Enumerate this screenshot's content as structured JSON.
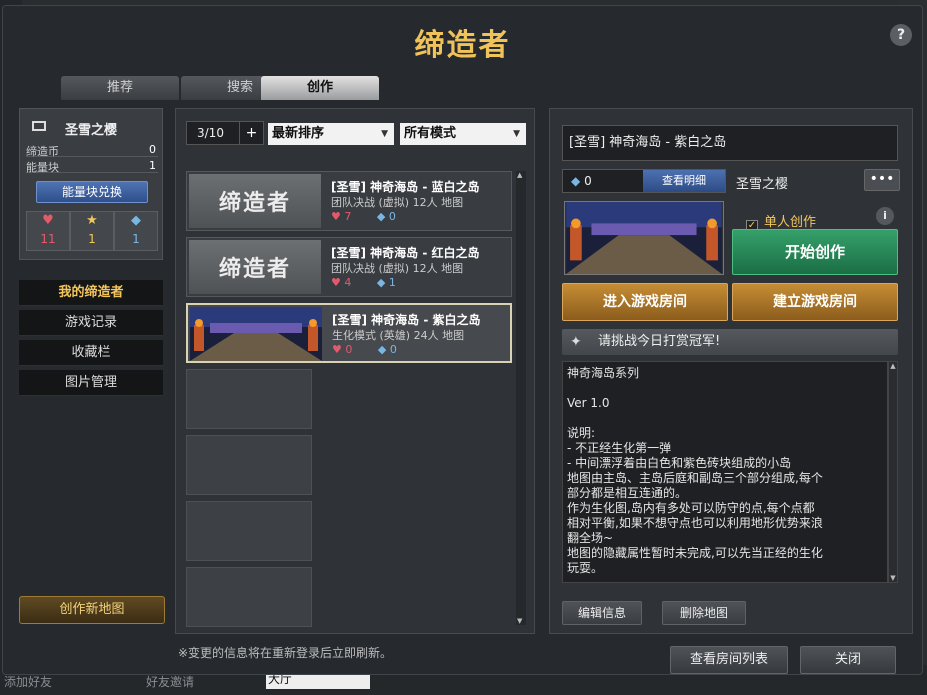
{
  "background": {
    "bottom_left_1": "添加好友",
    "bottom_left_2": "好友邀请",
    "bottom_channel": "大厅"
  },
  "dialog": {
    "title": "缔造者",
    "help": "?",
    "tabs": [
      "推荐",
      "搜索",
      "创作"
    ]
  },
  "profile": {
    "name": "圣雪之樱",
    "currency_label": "缔造币",
    "currency_value": "0",
    "energy_label": "能量块",
    "energy_value": "1",
    "exchange_button": "能量块兑换",
    "stats": [
      {
        "icon": "heart-icon",
        "glyph": "♥",
        "value": "11"
      },
      {
        "icon": "star-icon",
        "glyph": "★",
        "value": "1"
      },
      {
        "icon": "gem-icon",
        "glyph": "◆",
        "value": "1"
      }
    ]
  },
  "menu": [
    "我的缔造者",
    "游戏记录",
    "收藏栏",
    "图片管理"
  ],
  "create_new_map": "创作新地图",
  "list": {
    "page": "3/10",
    "plus": "+",
    "sort": "最新排序",
    "mode": "所有模式",
    "items": [
      {
        "title": "[圣雪] 神奇海岛 - 蓝白之岛",
        "sub": "团队决战 (虚拟)   12人 地图",
        "likes": "7",
        "gems": "0",
        "thumb": "缔造者"
      },
      {
        "title": "[圣雪] 神奇海岛 - 红白之岛",
        "sub": "团队决战 (虚拟)   12人 地图",
        "likes": "4",
        "gems": "1",
        "thumb": "缔造者"
      },
      {
        "title": "[圣雪] 神奇海岛 - 紫白之岛",
        "sub": "生化模式 (英雄)   24人 地图",
        "likes": "0",
        "gems": "0",
        "thumb": ""
      }
    ]
  },
  "detail": {
    "title": "[圣雪] 神奇海岛 - 紫白之岛",
    "gem_count": "0",
    "view_detail": "查看明细",
    "author": "圣雪之樱",
    "more": "•••",
    "single_create": "单人创作",
    "start_create": "开始创作",
    "enter_room": "进入游戏房间",
    "create_room": "建立游戏房间",
    "challenge": "请挑战今日打赏冠军!",
    "description": "神奇海岛系列\n\nVer 1.0\n\n说明:\n- 不正经生化第一弹\n- 中间漂浮着由白色和紫色砖块组成的小岛\n地图由主岛、主岛后庭和副岛三个部分组成,每个\n部分都是相互连通的。\n作为生化图,岛内有多处可以防守的点,每个点都\n相对平衡,如果不想守点也可以利用地形优势来浪\n翻全场~\n地图的隐藏属性暂时未完成,可以先当正经的生化\n玩耍。",
    "edit_info": "编辑信息",
    "delete_map": "删除地图"
  },
  "footer": {
    "note": "※变更的信息将在重新登录后立即刷新。",
    "view_rooms": "查看房间列表",
    "close": "关闭"
  },
  "colors": {
    "title": "#f0c25a",
    "start": "#1b6e45",
    "gold": "#c68d34",
    "accent_blue": "#2d4c86"
  }
}
